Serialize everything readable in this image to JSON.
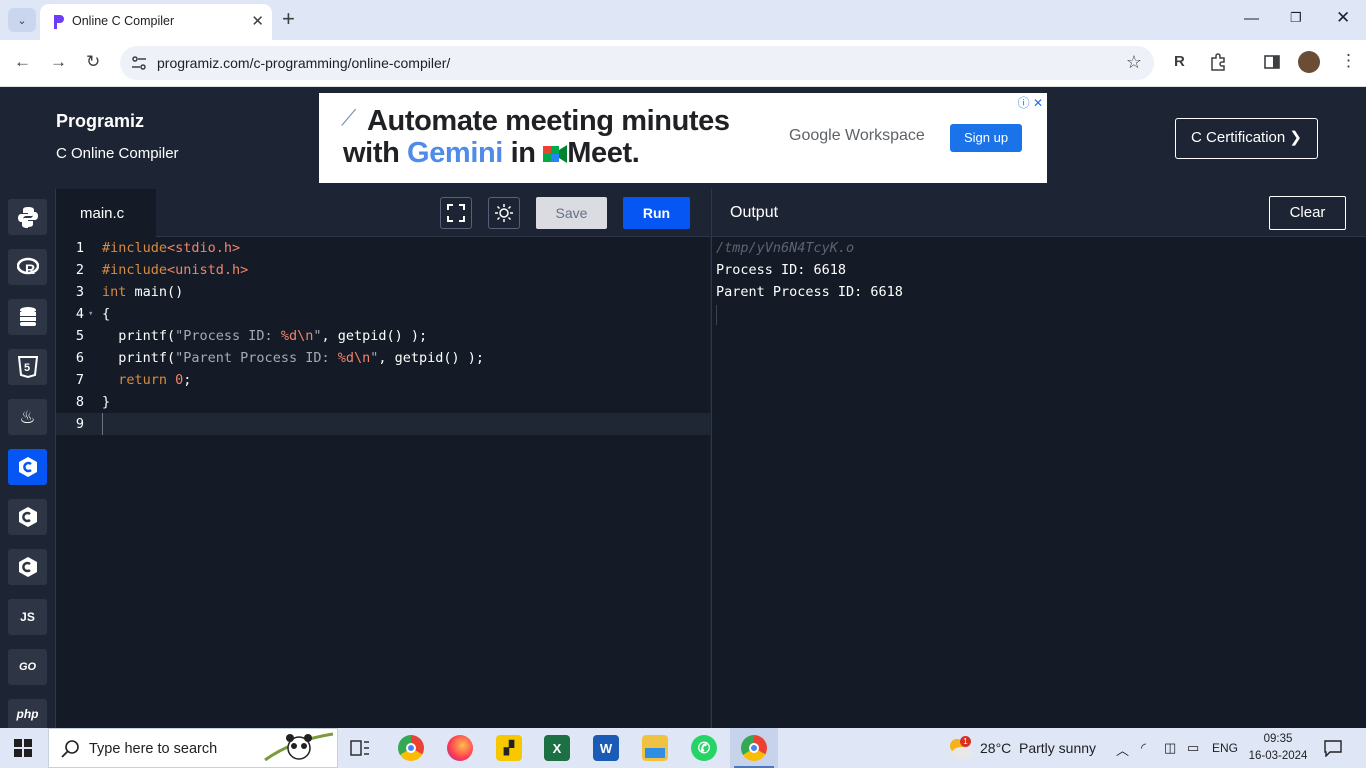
{
  "browser": {
    "tab_title": "Online C Compiler",
    "url": "programiz.com/c-programming/online-compiler/"
  },
  "header": {
    "logo": "Programiz",
    "subtitle": "C Online Compiler",
    "cert_button": "C Certification ❯"
  },
  "ad": {
    "line1": "Automate meeting minutes",
    "line2_prefix": "with ",
    "line2_gemini": "Gemini",
    "line2_mid": " in ",
    "line2_meet": "Meet.",
    "brand": "Google Workspace",
    "signup": "Sign up"
  },
  "sidebar": {
    "languages": [
      {
        "name": "python",
        "label": ""
      },
      {
        "name": "r",
        "label": ""
      },
      {
        "name": "sql",
        "label": ""
      },
      {
        "name": "html",
        "label": ""
      },
      {
        "name": "java",
        "label": ""
      },
      {
        "name": "c",
        "label": ""
      },
      {
        "name": "cpp",
        "label": ""
      },
      {
        "name": "csharp",
        "label": ""
      },
      {
        "name": "javascript",
        "label": "JS"
      },
      {
        "name": "go",
        "label": "GO"
      },
      {
        "name": "php",
        "label": "php"
      }
    ]
  },
  "editor": {
    "filename": "main.c",
    "save_label": "Save",
    "run_label": "Run",
    "line_numbers": [
      "1",
      "2",
      "3",
      "4",
      "5",
      "6",
      "7",
      "8",
      "9"
    ]
  },
  "code": {
    "l1": {
      "dir": "#include",
      "hdr": "<stdio.h>"
    },
    "l2": {
      "dir": "#include",
      "hdr": "<unistd.h>"
    },
    "l3": {
      "kw": "int",
      "rest": " main()"
    },
    "l4": {
      "text": "{"
    },
    "l5": {
      "fn": "  printf(",
      "s1": "\"Process ID: ",
      "fmt": "%d\\n",
      "s2": "\"",
      "rest": ", getpid() );"
    },
    "l6": {
      "fn": "  printf(",
      "s1": "\"Parent Process ID: ",
      "fmt": "%d\\n",
      "s2": "\"",
      "rest": ", getpid() );"
    },
    "l7": {
      "kw": "  return ",
      "num": "0",
      "rest": ";"
    },
    "l8": {
      "text": "}"
    }
  },
  "output": {
    "title": "Output",
    "clear_label": "Clear",
    "lines": [
      "/tmp/yVn6N4TcyK.o",
      "Process ID: 6618",
      "Parent Process ID: 6618"
    ]
  },
  "taskbar": {
    "search_placeholder": "Type here to search",
    "weather_temp": "28°C",
    "weather_desc": "Partly sunny",
    "language": "ENG",
    "time": "09:35",
    "date": "16-03-2024",
    "weather_badge": "1"
  }
}
